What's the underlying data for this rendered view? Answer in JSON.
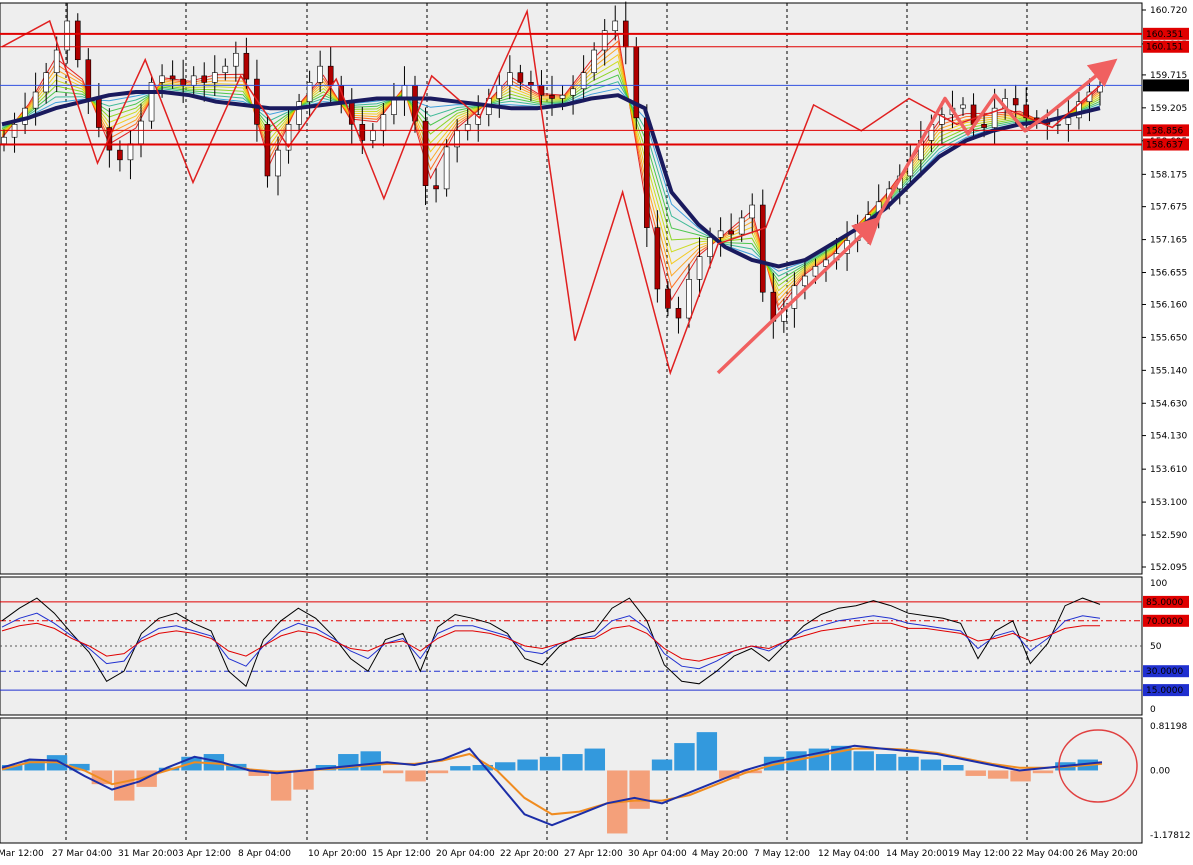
{
  "chart_data": [
    {
      "type": "candlestick",
      "panel": "price",
      "y_ticks": [
        "160.720",
        "160.195",
        "159.715",
        "159.205",
        "158.695",
        "158.175",
        "157.675",
        "157.165",
        "156.655",
        "156.160",
        "155.650",
        "155.140",
        "154.630",
        "154.130",
        "153.610",
        "153.100",
        "152.590",
        "152.095"
      ],
      "ylim": [
        152.095,
        160.72
      ],
      "x_labels": [
        "Mar 12:00",
        "27 Mar 04:00",
        "31 Mar 20:00",
        "3 Apr 12:00",
        "8 Apr 04:00",
        "10 Apr 20:00",
        "15 Apr 12:00",
        "20 Apr 04:00",
        "22 Apr 20:00",
        "27 Apr 12:00",
        "30 Apr 04:00",
        "4 May 20:00",
        "7 May 12:00",
        "12 May 04:00",
        "14 May 20:00",
        "19 May 12:00",
        "22 May 04:00",
        "26 May 20:00"
      ],
      "price_closes": [
        158.75,
        158.95,
        159.2,
        159.45,
        159.75,
        160.1,
        160.55,
        159.95,
        159.35,
        158.9,
        158.55,
        158.4,
        158.65,
        159.0,
        159.6,
        159.7,
        159.65,
        159.55,
        159.7,
        159.6,
        159.75,
        159.85,
        160.05,
        159.65,
        158.95,
        158.15,
        158.55,
        158.95,
        159.3,
        159.6,
        159.85,
        159.55,
        159.3,
        158.95,
        158.7,
        158.85,
        159.1,
        159.35,
        159.55,
        159.0,
        158.0,
        157.95,
        158.6,
        158.85,
        158.95,
        159.1,
        159.35,
        159.55,
        159.75,
        159.6,
        159.55,
        159.4,
        159.35,
        159.4,
        159.5,
        159.75,
        160.1,
        160.4,
        160.55,
        160.15,
        159.05,
        157.35,
        156.4,
        156.1,
        155.95,
        156.55,
        156.9,
        157.2,
        157.3,
        157.25,
        157.5,
        157.7,
        156.35,
        155.9,
        156.1,
        156.45,
        156.6,
        156.75,
        156.85,
        156.95,
        157.15,
        157.4,
        157.55,
        157.75,
        157.95,
        158.15,
        158.4,
        158.7,
        158.95,
        159.1,
        159.2,
        159.25,
        158.95,
        158.9,
        159.2,
        159.35,
        159.25,
        159.05,
        159.0,
        158.95,
        158.95,
        159.05,
        159.3,
        159.45,
        159.55
      ],
      "levels": [
        {
          "value": 160.351,
          "label": "160.351",
          "color": "#e00000",
          "style": "thick"
        },
        {
          "value": 160.151,
          "label": "160.151",
          "color": "#e00000",
          "style": "thin"
        },
        {
          "value": 159.552,
          "label": "159.552",
          "color": "#3050e0",
          "style": "current"
        },
        {
          "value": 158.856,
          "label": "158.856",
          "color": "#e00000",
          "style": "thin"
        },
        {
          "value": 158.637,
          "label": "158.637",
          "color": "#e00000",
          "style": "thick"
        }
      ],
      "zigzag": [
        160.15,
        160.55,
        158.35,
        159.95,
        158.05,
        159.7,
        158.6,
        159.65,
        157.8,
        159.7,
        159.05,
        160.7,
        155.6,
        157.9,
        155.1,
        157.1,
        157.35,
        159.25,
        158.85,
        159.35,
        158.95,
        159.2,
        158.9,
        159.55
      ],
      "moving_average": [
        158.95,
        159.05,
        159.2,
        159.3,
        159.4,
        159.45,
        159.45,
        159.4,
        159.3,
        159.25,
        159.2,
        159.2,
        159.25,
        159.3,
        159.35,
        159.35,
        159.35,
        159.3,
        159.25,
        159.2,
        159.2,
        159.25,
        159.35,
        159.4,
        159.2,
        157.9,
        157.4,
        157.05,
        156.85,
        156.75,
        156.85,
        157.1,
        157.35,
        157.65,
        158.05,
        158.45,
        158.7,
        158.85,
        158.95,
        159.0,
        159.1,
        159.2
      ]
    },
    {
      "type": "line",
      "panel": "oscillator",
      "ylim": [
        0,
        100
      ],
      "y_ticks": [
        "100",
        "50",
        "0"
      ],
      "levels": [
        {
          "value": 85,
          "label": "85.0000",
          "color": "#e00000"
        },
        {
          "value": 70,
          "label": "70.0000",
          "color": "#e00000"
        },
        {
          "value": 30,
          "label": "30.0000",
          "color": "#2030d0"
        },
        {
          "value": 15,
          "label": "15.0000",
          "color": "#2030d0"
        }
      ],
      "series": [
        {
          "values": [
            70,
            80,
            88,
            76,
            60,
            45,
            22,
            30,
            60,
            72,
            76,
            68,
            62,
            30,
            18,
            55,
            70,
            80,
            72,
            58,
            40,
            30,
            55,
            60,
            30,
            65,
            75,
            72,
            68,
            60,
            40,
            35,
            50,
            58,
            62,
            80,
            88,
            70,
            35,
            22,
            20,
            30,
            42,
            48,
            38,
            52,
            66,
            75,
            80,
            82,
            86,
            82,
            76,
            74,
            72,
            68,
            40,
            62,
            70,
            36,
            52,
            82,
            88,
            83
          ]
        },
        {
          "values": [
            65,
            72,
            76,
            68,
            58,
            48,
            36,
            38,
            56,
            64,
            66,
            62,
            58,
            40,
            34,
            50,
            62,
            68,
            64,
            56,
            46,
            40,
            52,
            56,
            40,
            60,
            66,
            66,
            62,
            58,
            46,
            44,
            52,
            56,
            58,
            70,
            74,
            64,
            44,
            34,
            32,
            38,
            46,
            50,
            46,
            54,
            62,
            66,
            70,
            72,
            74,
            72,
            68,
            66,
            64,
            62,
            48,
            58,
            62,
            46,
            56,
            70,
            74,
            72
          ]
        },
        {
          "values": [
            62,
            66,
            68,
            64,
            56,
            50,
            42,
            44,
            54,
            60,
            62,
            60,
            56,
            46,
            42,
            50,
            58,
            62,
            60,
            54,
            48,
            46,
            52,
            54,
            46,
            56,
            62,
            62,
            60,
            56,
            50,
            48,
            52,
            56,
            56,
            64,
            66,
            60,
            48,
            40,
            38,
            42,
            46,
            50,
            48,
            54,
            58,
            62,
            64,
            66,
            68,
            68,
            64,
            64,
            62,
            60,
            54,
            56,
            60,
            54,
            58,
            64,
            66,
            66
          ]
        }
      ]
    },
    {
      "type": "histogram",
      "panel": "macd",
      "ylim": [
        -1.17812,
        0.81198
      ],
      "y_ticks": [
        "0.81198",
        "0.00",
        "-1.17812"
      ],
      "histogram": [
        0.1,
        0.2,
        0.28,
        0.12,
        -0.25,
        -0.55,
        -0.3,
        0.05,
        0.25,
        0.3,
        0.12,
        -0.1,
        -0.55,
        -0.35,
        0.1,
        0.3,
        0.35,
        -0.05,
        -0.2,
        -0.05,
        0.08,
        0.1,
        0.15,
        0.2,
        0.25,
        0.3,
        0.4,
        -1.15,
        -0.7,
        0.2,
        0.5,
        0.7,
        -0.15,
        -0.05,
        0.25,
        0.35,
        0.4,
        0.45,
        0.35,
        0.3,
        0.25,
        0.2,
        0.1,
        -0.1,
        -0.15,
        -0.2,
        -0.05,
        0.15,
        0.2
      ],
      "macd": [
        0.05,
        0.2,
        0.18,
        -0.1,
        -0.35,
        -0.2,
        0.05,
        0.25,
        0.15,
        0.0,
        -0.05,
        0.0,
        0.05,
        0.1,
        0.15,
        0.1,
        0.2,
        0.4,
        -0.2,
        -0.8,
        -1.0,
        -0.8,
        -0.6,
        -0.5,
        -0.6,
        -0.4,
        -0.2,
        0.0,
        0.15,
        0.25,
        0.35,
        0.45,
        0.4,
        0.35,
        0.3,
        0.2,
        0.1,
        0.0,
        0.05,
        0.1,
        0.15
      ],
      "signal": [
        0.02,
        0.15,
        0.15,
        0.0,
        -0.25,
        -0.15,
        0.0,
        0.15,
        0.12,
        0.02,
        -0.02,
        0.0,
        0.03,
        0.08,
        0.12,
        0.12,
        0.18,
        0.3,
        0.0,
        -0.5,
        -0.8,
        -0.75,
        -0.6,
        -0.55,
        -0.55,
        -0.45,
        -0.25,
        -0.05,
        0.1,
        0.2,
        0.3,
        0.4,
        0.4,
        0.38,
        0.32,
        0.22,
        0.12,
        0.05,
        0.05,
        0.08,
        0.12
      ]
    }
  ],
  "colors": {
    "candle_up": "#ffffff",
    "candle_down": "#b00000",
    "zigzag": "#e02020",
    "ma_thick": "#1a1a5e",
    "arrow": "#f06060",
    "grid": "#000000",
    "hist_pos": "#3399dd",
    "hist_neg": "#f4a07a",
    "macd_line": "#1c2ea8",
    "signal_line": "#f08c20",
    "osc_black": "#000000",
    "osc_blue": "#2030d0",
    "osc_red": "#e00000",
    "circle": "#e04040"
  }
}
